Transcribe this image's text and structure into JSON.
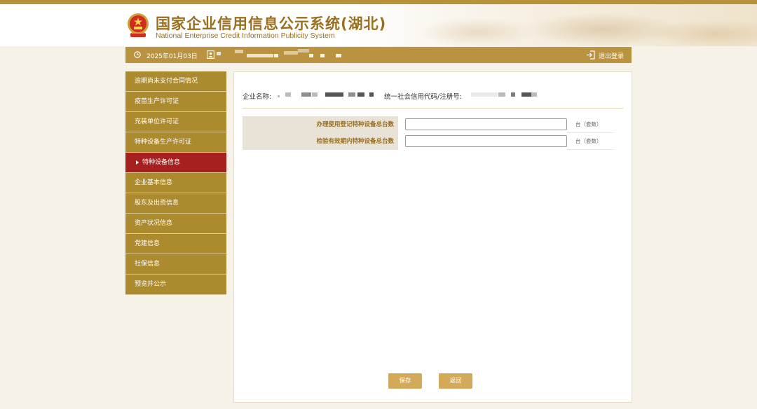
{
  "header": {
    "title": "国家企业信用信息公示系统(湖北)",
    "subtitle": "National Enterprise Credit Information Publicity System"
  },
  "userbar": {
    "date": "2025年01月03日",
    "logout_label": "退出登录"
  },
  "sidebar": {
    "items": [
      {
        "label": "逾期尚未支付合同情况",
        "active": false
      },
      {
        "label": "疫苗生产许可证",
        "active": false
      },
      {
        "label": "充装单位许可证",
        "active": false
      },
      {
        "label": "特种设备生产许可证",
        "active": false
      },
      {
        "label": "特种设备信息",
        "active": true
      },
      {
        "label": "企业基本信息",
        "active": false
      },
      {
        "label": "股东及出资信息",
        "active": false
      },
      {
        "label": "资产状况信息",
        "active": false
      },
      {
        "label": "党建信息",
        "active": false
      },
      {
        "label": "社保信息",
        "active": false
      },
      {
        "label": "预览并公示",
        "active": false
      }
    ]
  },
  "main": {
    "company_name_label": "企业名称:",
    "credit_code_label": "统一社会信用代码/注册号:",
    "form": {
      "rows": [
        {
          "label": "办理使用登记特种设备总台数",
          "value": "",
          "unit": "台（套数）"
        },
        {
          "label": "检验有效期内特种设备总台数",
          "value": "",
          "unit": "台（套数）"
        }
      ]
    },
    "buttons": {
      "save_label": "保存",
      "back_label": "返回"
    }
  },
  "colors": {
    "brand_gold": "#b99340",
    "sidebar_bg": "#ac8a2e",
    "active_red": "#a5201e",
    "button_gold": "#d3aa5a"
  },
  "icons": [
    "national-emblem-icon",
    "clock-icon",
    "user-icon",
    "logout-icon",
    "arrow-right-icon"
  ]
}
